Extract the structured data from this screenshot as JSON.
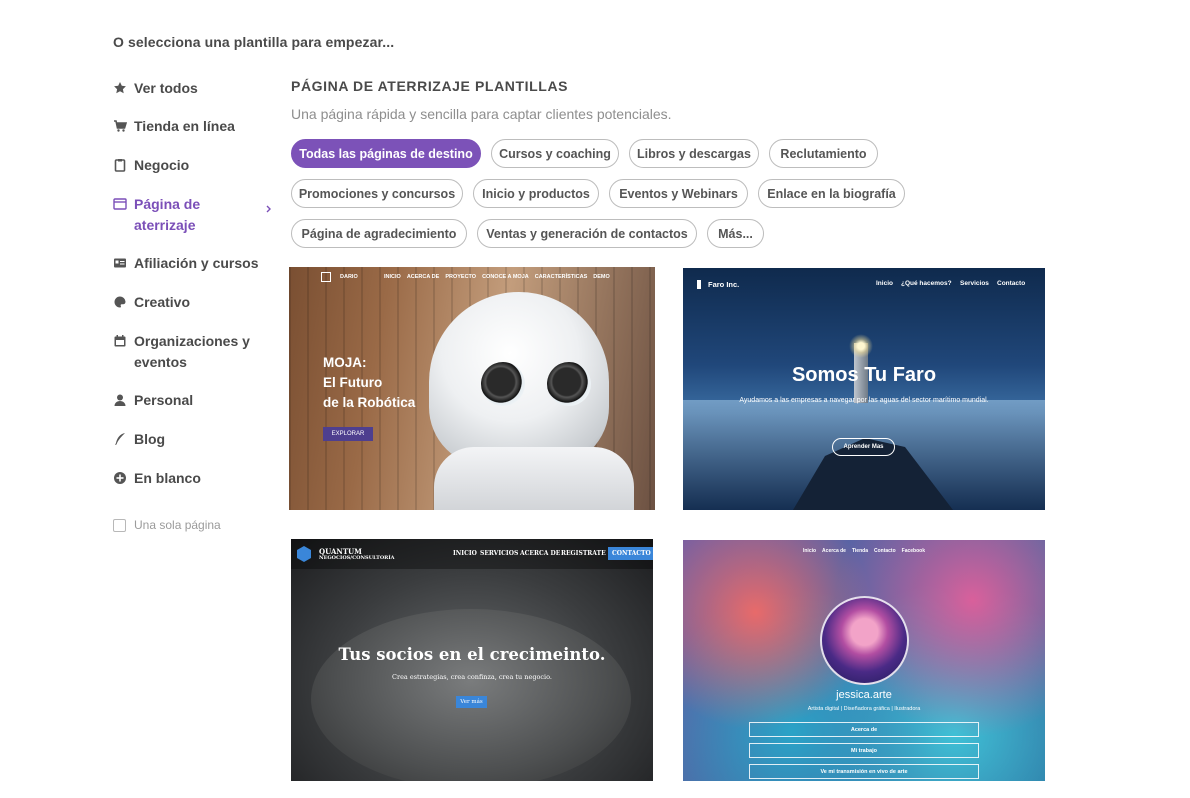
{
  "heading": "O selecciona una plantilla para empezar...",
  "sidebar": {
    "items": [
      {
        "label": "Ver todos",
        "icon": "star-icon"
      },
      {
        "label": "Tienda en línea",
        "icon": "cart-icon"
      },
      {
        "label": "Negocio",
        "icon": "clipboard-icon"
      },
      {
        "label": "Página de aterrizaje",
        "icon": "window-icon",
        "active": true
      },
      {
        "label": "Afiliación y cursos",
        "icon": "id-card-icon"
      },
      {
        "label": "Creativo",
        "icon": "palette-icon"
      },
      {
        "label": "Organizaciones y eventos",
        "icon": "calendar-icon"
      },
      {
        "label": "Personal",
        "icon": "person-icon"
      },
      {
        "label": "Blog",
        "icon": "quill-icon"
      },
      {
        "label": "En blanco",
        "icon": "plus-circle-icon"
      }
    ],
    "single_page_label": "Una sola página"
  },
  "section": {
    "title": "PÁGINA DE ATERRIZAJE PLANTILLAS",
    "subtitle": "Una página rápida y sencilla para captar clientes potenciales."
  },
  "filters": [
    "Todas las páginas de destino",
    "Cursos y coaching",
    "Libros y descargas",
    "Reclutamiento",
    "Promociones y concursos",
    "Inicio y productos",
    "Eventos y Webinars",
    "Enlace en la biografía",
    "Página de agradecimiento",
    "Ventas y generación de contactos",
    "Más..."
  ],
  "accent_color": "#7c52b8",
  "templates": {
    "robot": {
      "brand": "DARIO",
      "nav": [
        "INICIO",
        "ACERCA DE",
        "PROYECTO",
        "CONOCE A MOJA",
        "CARACTERÍSTICAS",
        "DEMO"
      ],
      "title_lines": [
        "MOJA:",
        "El Futuro",
        "de la Robótica"
      ],
      "button": "EXPLORAR"
    },
    "lighthouse": {
      "brand": "Faro Inc.",
      "nav": [
        "Inicio",
        "¿Qué hacemos?",
        "Servicios",
        "Contacto"
      ],
      "title": "Somos Tu Faro",
      "subtitle": "Ayudamos a las empresas a navegar por las aguas del sector marítimo mundial.",
      "button": "Aprender Mas"
    },
    "business": {
      "brand": "QUANTUM",
      "brand_sub": "NEGOCIOS/CONSULTORÍA",
      "nav": [
        "INICIO",
        "SERVICIOS",
        "ACERCA DE",
        "REGISTRATE"
      ],
      "nav_cta": "CONTACTO",
      "title": "Tus socios en el crecimeinto.",
      "subtitle": "Crea estrategias, crea confinza, crea tu negocio.",
      "button": "Ver más"
    },
    "artist": {
      "nav": [
        "Inicio",
        "Acerca de",
        "Tienda",
        "Contacto",
        "Facebook"
      ],
      "name": "jessica.arte",
      "role": "Artista digital | Diseñadora gráfica | Ilustradora",
      "links": [
        "Acerca de",
        "Mi trabajo",
        "Ve mi transmisión en vivo de arte"
      ]
    }
  }
}
